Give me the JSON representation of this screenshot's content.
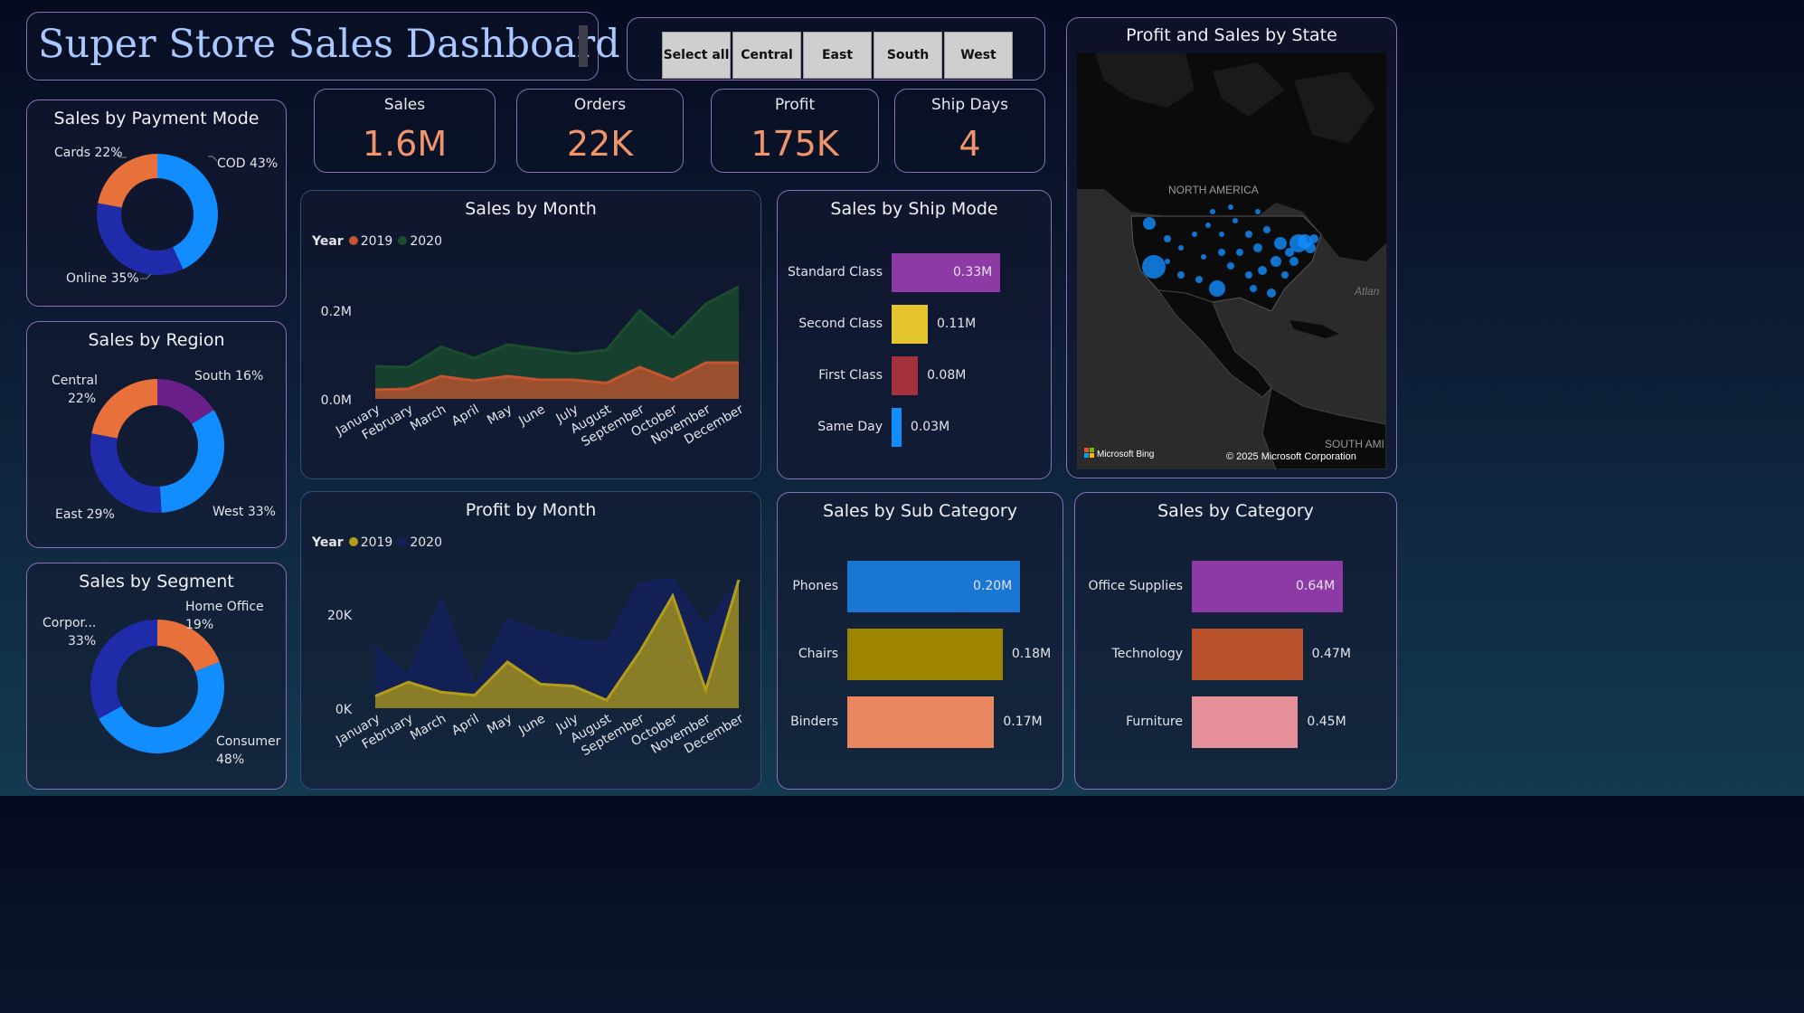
{
  "header": {
    "title": "Super Store Sales Dashboard"
  },
  "slicer": {
    "buttons": [
      "Select all",
      "Central",
      "East",
      "South",
      "West"
    ]
  },
  "kpis": [
    {
      "label": "Sales",
      "value": "1.6M"
    },
    {
      "label": "Orders",
      "value": "22K"
    },
    {
      "label": "Profit",
      "value": "175K"
    },
    {
      "label": "Ship Days",
      "value": "4"
    }
  ],
  "payment": {
    "title": "Sales by Payment Mode",
    "labels": [
      "COD 43%",
      "Online 35%",
      "Cards 22%"
    ]
  },
  "region": {
    "title": "Sales by Region",
    "labels": [
      "South 16%",
      "West 33%",
      "East 29%",
      "Central",
      "22%"
    ]
  },
  "segment": {
    "title": "Sales by Segment",
    "labels": [
      "Home Office",
      "19%",
      "Consumer",
      "48%",
      "Corpor...",
      "33%"
    ]
  },
  "map": {
    "title": "Profit and Sales by State",
    "region_label": "NORTH AMERICA",
    "ocean_label": "Atlan",
    "south_label": "SOUTH AMI",
    "brand": "Microsoft Bing",
    "copyright": "© 2025 Microsoft Corporation"
  },
  "sales_month": {
    "title": "Sales by Month",
    "legend_title": "Year",
    "legend": [
      "2019",
      "2020"
    ],
    "yticks": [
      "0.2M",
      "0.0M"
    ]
  },
  "profit_month": {
    "title": "Profit by Month",
    "legend_title": "Year",
    "legend": [
      "2019",
      "2020"
    ],
    "yticks": [
      "20K",
      "0K"
    ]
  },
  "ship_mode": {
    "title": "Sales by Ship Mode"
  },
  "sub_category": {
    "title": "Sales by Sub Category"
  },
  "category": {
    "title": "Sales by Category"
  },
  "chart_data": [
    {
      "type": "pie",
      "title": "Sales by Payment Mode",
      "categories": [
        "COD",
        "Online",
        "Cards"
      ],
      "values": [
        43,
        35,
        22
      ],
      "colors": [
        "#118dff",
        "#1f2ba8",
        "#e8703a"
      ]
    },
    {
      "type": "pie",
      "title": "Sales by Region",
      "categories": [
        "South",
        "West",
        "East",
        "Central"
      ],
      "values": [
        16,
        33,
        29,
        22
      ],
      "colors": [
        "#6b1f8a",
        "#118dff",
        "#1f2ba8",
        "#e8703a"
      ]
    },
    {
      "type": "pie",
      "title": "Sales by Segment",
      "categories": [
        "Home Office",
        "Consumer",
        "Corporate"
      ],
      "values": [
        19,
        48,
        33
      ],
      "colors": [
        "#e8703a",
        "#118dff",
        "#1f2ba8"
      ]
    },
    {
      "type": "area",
      "title": "Sales by Month",
      "categories": [
        "January",
        "February",
        "March",
        "April",
        "May",
        "June",
        "July",
        "August",
        "September",
        "October",
        "November",
        "December"
      ],
      "ylim": [
        0,
        0.25
      ],
      "series": [
        {
          "name": "2019",
          "values": [
            0.02,
            0.022,
            0.05,
            0.04,
            0.05,
            0.042,
            0.042,
            0.035,
            0.07,
            0.042,
            0.08,
            0.08
          ],
          "color": "#c5552f"
        },
        {
          "name": "2020",
          "values": [
            0.072,
            0.07,
            0.115,
            0.09,
            0.12,
            0.11,
            0.1,
            0.108,
            0.195,
            0.135,
            0.21,
            0.248
          ],
          "color": "#1b4d2e"
        }
      ]
    },
    {
      "type": "area",
      "title": "Profit by Month",
      "categories": [
        "January",
        "February",
        "March",
        "April",
        "May",
        "June",
        "July",
        "August",
        "September",
        "October",
        "November",
        "December"
      ],
      "ylim": [
        0,
        32000
      ],
      "series": [
        {
          "name": "2019",
          "values": [
            3000,
            6500,
            4000,
            3200,
            11500,
            6000,
            5500,
            2000,
            14000,
            28000,
            4500,
            33000
          ],
          "color": "#b39c1a"
        },
        {
          "name": "2020",
          "values": [
            15000,
            8000,
            27000,
            5000,
            22000,
            19000,
            17000,
            16000,
            31000,
            40000,
            20000,
            40000
          ],
          "color": "#13205e"
        }
      ]
    },
    {
      "type": "bar",
      "title": "Sales by Ship Mode",
      "categories": [
        "Standard Class",
        "Second Class",
        "First Class",
        "Same Day"
      ],
      "values": [
        0.33,
        0.11,
        0.08,
        0.03
      ],
      "labels": [
        "0.33M",
        "0.11M",
        "0.08M",
        "0.03M"
      ],
      "colors": [
        "#8e3aa6",
        "#e5c52f",
        "#a3323c",
        "#118dff"
      ]
    },
    {
      "type": "bar",
      "title": "Sales by Sub Category",
      "categories": [
        "Phones",
        "Chairs",
        "Binders"
      ],
      "values": [
        0.2,
        0.18,
        0.17
      ],
      "labels": [
        "0.20M",
        "0.18M",
        "0.17M"
      ],
      "colors": [
        "#1976d2",
        "#9e8500",
        "#ea8760"
      ]
    },
    {
      "type": "bar",
      "title": "Sales by Category",
      "categories": [
        "Office Supplies",
        "Technology",
        "Furniture"
      ],
      "values": [
        0.64,
        0.47,
        0.45
      ],
      "labels": [
        "0.64M",
        "0.47M",
        "0.45M"
      ],
      "colors": [
        "#8e3aa6",
        "#b8512b",
        "#e6909a"
      ]
    }
  ]
}
